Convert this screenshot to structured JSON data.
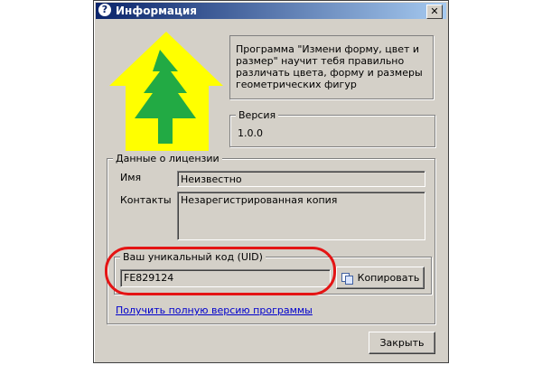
{
  "window": {
    "title": "Информация",
    "help_glyph": "?",
    "close_glyph": "✕"
  },
  "description": "Программа \"Измени форму, цвет и размер\" научит тебя правильно различать цвета, форму и размеры геометрических фигур",
  "version": {
    "legend": "Версия",
    "value": "1.0.0"
  },
  "license": {
    "legend": "Данные о лицензии",
    "name_label": "Имя",
    "name_value": "Неизвестно",
    "contacts_label": "Контакты",
    "contacts_value": "Незарегистрированная копия",
    "uid_legend": "Ваш уникальный код (UID)",
    "uid_value": "FE829124",
    "copy_label": "Копировать"
  },
  "full_version_link": "Получить полную версию программы",
  "close_label": "Закрыть",
  "colors": {
    "house": "#ffff00",
    "tree": "#22aa44",
    "highlight": "#e41414",
    "link": "#0000cc"
  },
  "icons": [
    "help-icon",
    "close-icon",
    "house-tree-logo",
    "copy-icon"
  ]
}
